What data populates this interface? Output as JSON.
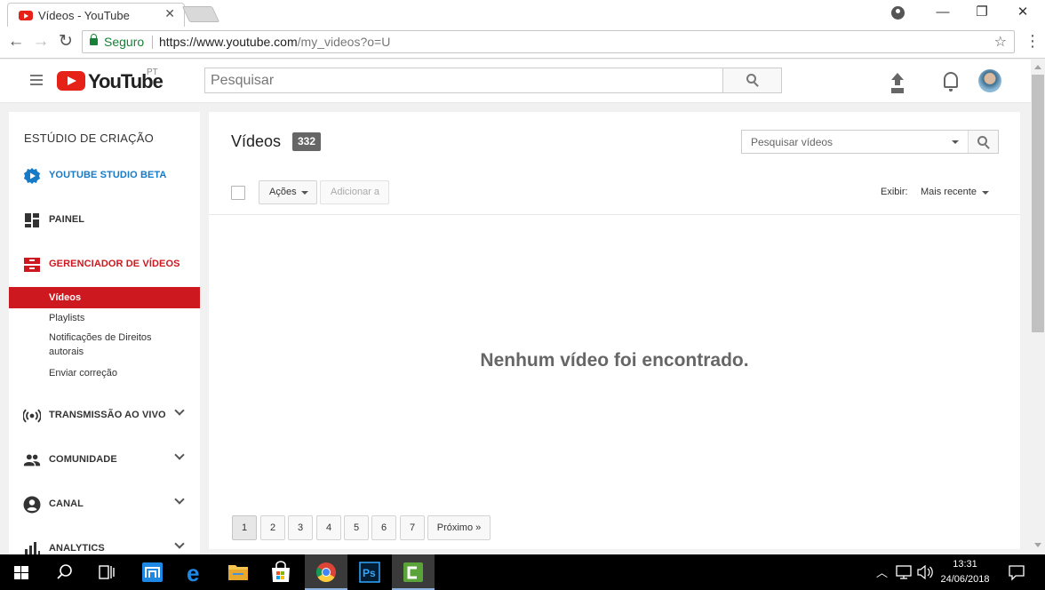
{
  "browser": {
    "tab_title": "Vídeos - YouTube",
    "tab_close": "✕",
    "window_minimize": "—",
    "window_maximize": "❐",
    "window_close": "✕",
    "back": "←",
    "forward": "→",
    "reload": "↻",
    "secure_label": "Seguro",
    "url_host": "https://www.youtube.com",
    "url_path": "/my_videos?o=U",
    "bookmark_star": "☆",
    "menu": "⋮"
  },
  "youtube_header": {
    "logo_text": "YouTube",
    "logo_country": "PT",
    "search_placeholder": "Pesquisar"
  },
  "sidebar": {
    "title": "ESTÚDIO DE CRIAÇÃO",
    "items": [
      {
        "label": "YOUTUBE STUDIO BETA",
        "icon": "gear-play-icon"
      },
      {
        "label": "PAINEL",
        "icon": "dashboard-icon"
      },
      {
        "label": "GERENCIADOR DE VÍDEOS",
        "icon": "video-manager-icon"
      },
      {
        "label": "TRANSMISSÃO AO VIVO",
        "icon": "live-broadcast-icon"
      },
      {
        "label": "COMUNIDADE",
        "icon": "community-icon"
      },
      {
        "label": "CANAL",
        "icon": "channel-icon"
      },
      {
        "label": "ANALYTICS",
        "icon": "analytics-icon"
      }
    ],
    "sub_items": [
      {
        "label": "Vídeos",
        "active": true
      },
      {
        "label": "Playlists",
        "active": false
      },
      {
        "label": "Notificações de Direitos autorais",
        "active": false
      },
      {
        "label": "Enviar correção",
        "active": false
      }
    ]
  },
  "main": {
    "title": "Vídeos",
    "count": "332",
    "search_placeholder": "Pesquisar vídeos",
    "actions_label": "Ações",
    "add_to_label": "Adicionar a",
    "view_label": "Exibir:",
    "sort_value": "Mais recente",
    "empty_message": "Nenhum vídeo foi encontrado.",
    "pagination": [
      "1",
      "2",
      "3",
      "4",
      "5",
      "6",
      "7"
    ],
    "next_label": "Próximo »",
    "current_page": "1"
  },
  "taskbar": {
    "time": "13:31",
    "date": "24/06/2018",
    "apps": [
      "windows-start-icon",
      "search-icon",
      "task-view-icon",
      "maxthon-icon",
      "edge-icon",
      "file-explorer-icon",
      "store-icon",
      "chrome-icon",
      "photoshop-icon",
      "camtasia-icon"
    ],
    "ps_label": "Ps"
  },
  "colors": {
    "youtube_red": "#e62117",
    "studio_red": "#cc181e",
    "studio_blue": "#167ac6",
    "secure_green": "#188038"
  }
}
